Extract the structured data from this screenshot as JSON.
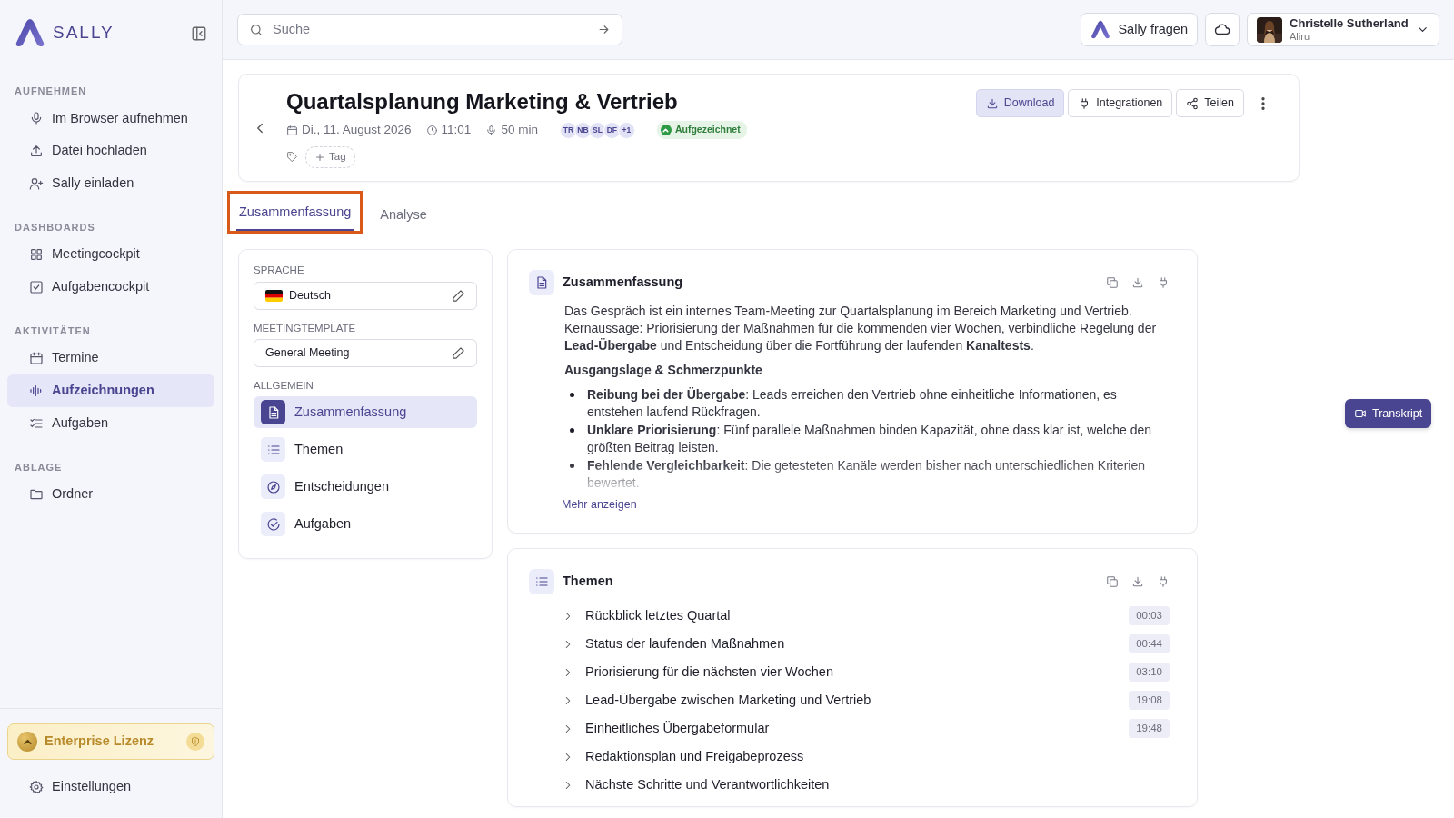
{
  "sidebar": {
    "brand": "SALLY",
    "sections": [
      {
        "heading": "AUFNEHMEN",
        "items": [
          {
            "label": "Im Browser aufnehmen",
            "selected": false
          },
          {
            "label": "Datei hochladen",
            "selected": false
          },
          {
            "label": "Sally einladen",
            "selected": false
          }
        ]
      },
      {
        "heading": "DASHBOARDS",
        "items": [
          {
            "label": "Meetingcockpit",
            "selected": false
          },
          {
            "label": "Aufgabencockpit",
            "selected": false
          }
        ]
      },
      {
        "heading": "AKTIVITÄTEN",
        "items": [
          {
            "label": "Termine",
            "selected": false
          },
          {
            "label": "Aufzeichnungen",
            "selected": true
          },
          {
            "label": "Aufgaben",
            "selected": false
          }
        ]
      },
      {
        "heading": "ABLAGE",
        "items": [
          {
            "label": "Ordner",
            "selected": false
          }
        ]
      }
    ],
    "license": "Enterprise Lizenz",
    "settings": "Einstellungen"
  },
  "header": {
    "search": {
      "placeholder": "Suche"
    },
    "ask_button": "Sally fragen",
    "user": {
      "name": "Christelle Sutherland",
      "org": "Aliru"
    }
  },
  "meeting": {
    "title": "Quartalsplanung Marketing & Vertrieb",
    "date": "Di., 11. August 2026",
    "time": "11:01",
    "duration": "50 min",
    "participants": [
      "TR",
      "NB",
      "SL",
      "DF",
      "+1"
    ],
    "status": "Aufgezeichnet",
    "tag_button": "Tag",
    "actions": [
      {
        "label": "Download",
        "selected": true
      },
      {
        "label": "Integrationen",
        "selected": false
      },
      {
        "label": "Teilen",
        "selected": false
      }
    ]
  },
  "tabs": [
    {
      "label": "Zusammenfassung",
      "selected": true,
      "highlighted": true
    },
    {
      "label": "Analyse",
      "selected": false,
      "highlighted": false
    }
  ],
  "settings_panel": {
    "language": {
      "label": "SPRACHE",
      "value": "Deutsch"
    },
    "template": {
      "label": "MEETINGTEMPLATE",
      "value": "General Meeting"
    },
    "section_heading": "ALLGEMEIN",
    "items": [
      {
        "label": "Zusammenfassung",
        "selected": true
      },
      {
        "label": "Themen",
        "selected": false
      },
      {
        "label": "Entscheidungen",
        "selected": false
      },
      {
        "label": "Aufgaben",
        "selected": false
      }
    ]
  },
  "summary": {
    "title": "Zusammenfassung",
    "collapsed": true,
    "paragraph": "Das Gespräch ist ein internes Team-Meeting zur Quartalsplanung im Bereich Marketing und Vertrieb. Kernaussage: Priorisierung der Maßnahmen für die kommenden vier Wochen, verbindliche Regelung der **Lead-Übergabe** und Entscheidung über die Fortführung der laufenden **Kanaltests**.",
    "subheading": "Ausgangslage & Schmerzpunkte",
    "bullets": [
      "**Reibung bei der Übergabe**: Leads erreichen den Vertrieb ohne einheitliche Informationen, es entstehen laufend Rückfragen.",
      "**Unklare Priorisierung**: Fünf parallele Maßnahmen binden Kapazität, ohne dass klar ist, welche den größten Beitrag leisten.",
      "**Fehlende Vergleichbarkeit**: Die getesteten Kanäle werden bisher nach unterschiedlichen Kriterien bewertet."
    ],
    "more_link": "Mehr anzeigen"
  },
  "topics": {
    "title": "Themen",
    "items": [
      {
        "label": "Rückblick letztes Quartal",
        "time": "00:03"
      },
      {
        "label": "Status der laufenden Maßnahmen",
        "time": "00:44"
      },
      {
        "label": "Priorisierung für die nächsten vier Wochen",
        "time": "03:10"
      },
      {
        "label": "Lead-Übergabe zwischen Marketing und Vertrieb",
        "time": "19:08"
      },
      {
        "label": "Einheitliches Übergabeformular",
        "time": "19:48"
      },
      {
        "label": "Redaktionsplan und Freigabeprozess"
      },
      {
        "label": "Nächste Schritte und Verantwortlichkeiten"
      }
    ]
  },
  "transcript_button": "Transkript"
}
